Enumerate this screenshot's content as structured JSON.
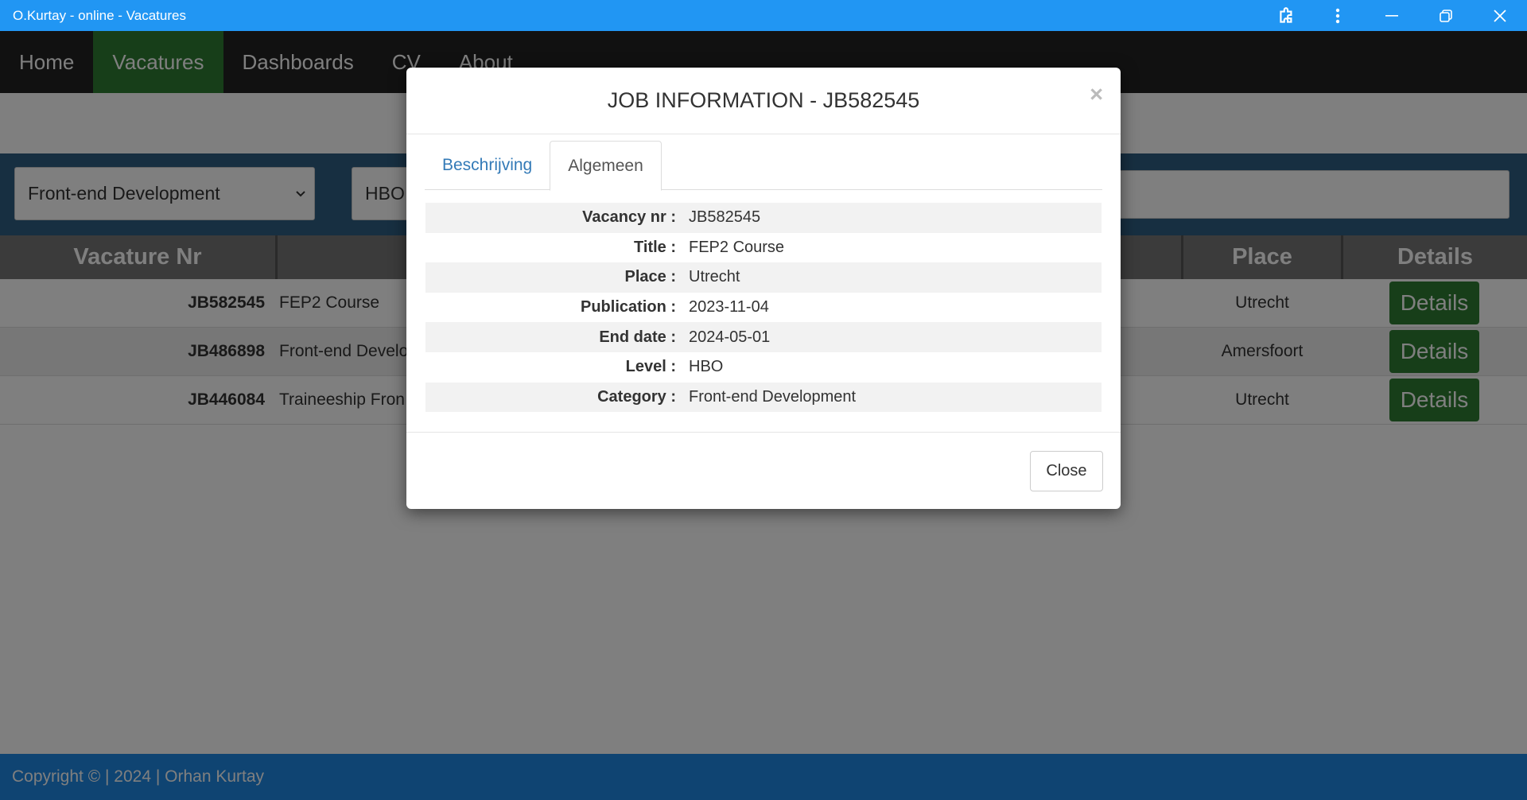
{
  "window": {
    "title": "O.Kurtay - online - Vacatures"
  },
  "nav": {
    "items": [
      "Home",
      "Vacatures",
      "Dashboards",
      "CV",
      "About"
    ],
    "active": "Vacatures"
  },
  "filters": {
    "category": "Front-end Development",
    "level": "HBO"
  },
  "table": {
    "headers": {
      "nr": "Vacature Nr",
      "place": "Place",
      "details": "Details"
    },
    "rows": [
      {
        "nr": "JB582545",
        "title": "FEP2 Course",
        "place": "Utrecht",
        "action": "Details"
      },
      {
        "nr": "JB486898",
        "title": "Front-end Develo",
        "place": "Amersfoort",
        "action": "Details"
      },
      {
        "nr": "JB446084",
        "title": "Traineeship Fron",
        "place": "Utrecht",
        "action": "Details"
      }
    ]
  },
  "footer": {
    "text": "Copyright © | 2024 | Orhan Kurtay"
  },
  "modal": {
    "title": "JOB INFORMATION - JB582545",
    "close_x": "×",
    "tabs": [
      "Beschrijving",
      "Algemeen"
    ],
    "active_tab": "Algemeen",
    "fields": [
      {
        "label": "Vacancy nr :",
        "value": "JB582545"
      },
      {
        "label": "Title :",
        "value": "FEP2 Course"
      },
      {
        "label": "Place :",
        "value": "Utrecht"
      },
      {
        "label": "Publication :",
        "value": "2023-11-04"
      },
      {
        "label": "End date :",
        "value": "2024-05-01"
      },
      {
        "label": "Level :",
        "value": "HBO"
      },
      {
        "label": "Category :",
        "value": "Front-end Development"
      }
    ],
    "close_button": "Close"
  },
  "colors": {
    "titlebar": "#2196f3",
    "nav_active": "#2e7d32",
    "footer": "#1e88e5",
    "details_button": "#2e7d32"
  }
}
